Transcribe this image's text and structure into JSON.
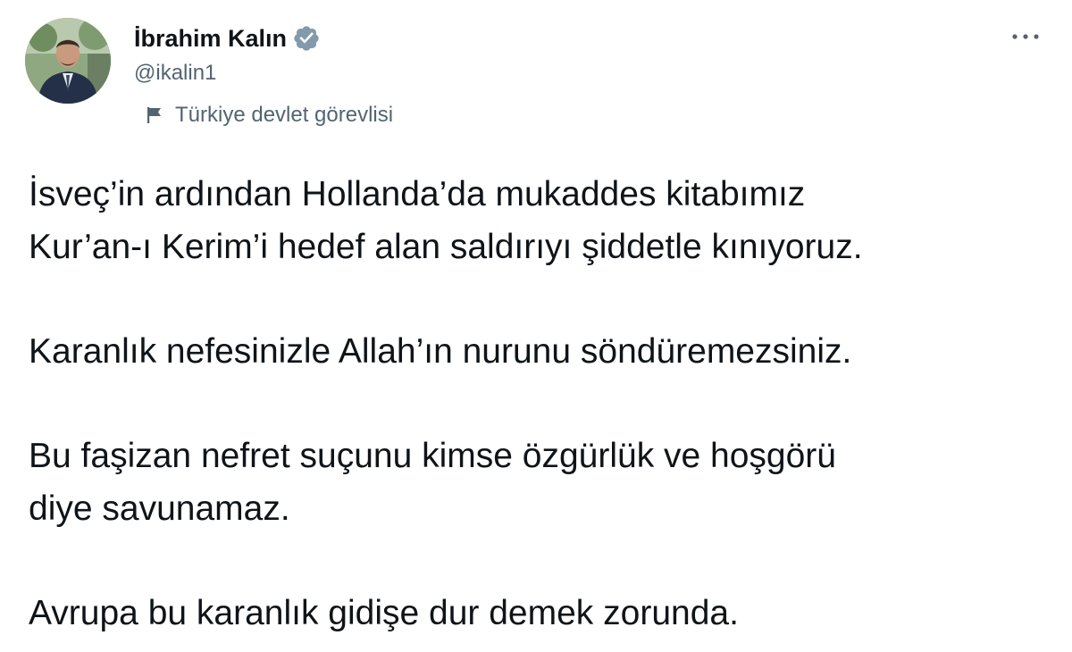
{
  "author": {
    "display_name": "İbrahim Kalın",
    "handle": "@ikalin1",
    "verified_icon": "verified-badge-icon",
    "label_icon": "flag-icon",
    "label": "Türkiye devlet görevlisi"
  },
  "menu": {
    "more_icon": "more-options-icon"
  },
  "tweet": {
    "paragraphs": [
      "İsveç’in ardından Hollanda’da mukaddes kitabımız\nKur’an-ı Kerim’i hedef alan saldırıyı şiddetle kınıyoruz.",
      "Karanlık nefesinizle Allah’ın nurunu söndüremezsiniz.",
      "Bu faşizan nefret suçunu kimse özgürlük ve hoşgörü\ndiye savunamaz.",
      "Avrupa bu karanlık gidişe dur demek zorunda."
    ]
  },
  "colors": {
    "text_primary": "#0f1419",
    "text_secondary": "#536471",
    "background": "#ffffff"
  }
}
